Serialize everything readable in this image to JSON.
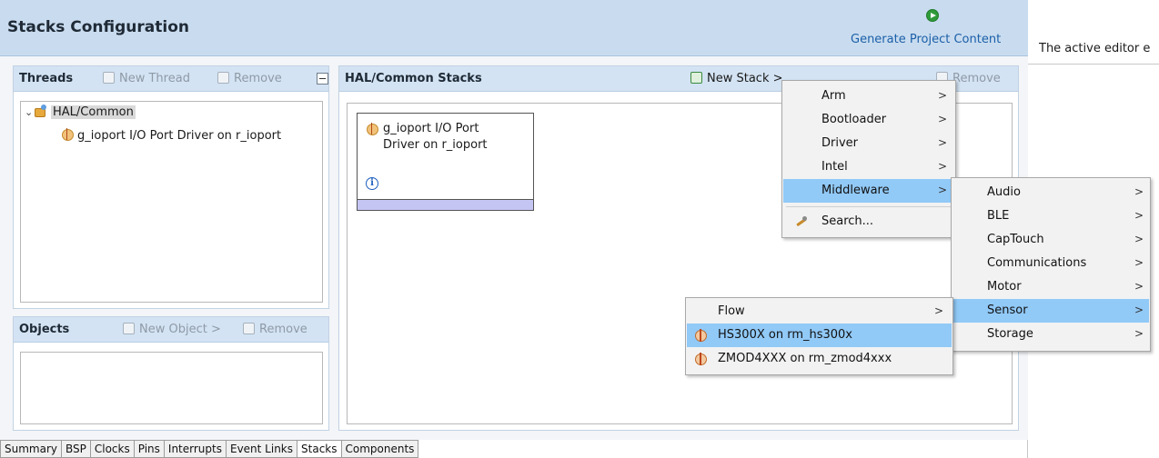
{
  "header": {
    "title": "Stacks Configuration",
    "generate_label": "Generate Project Content"
  },
  "threads": {
    "title": "Threads",
    "new_thread": "New Thread",
    "remove": "Remove",
    "tree_root": "HAL/Common",
    "tree_child": "g_ioport I/O Port Driver on r_ioport"
  },
  "objects": {
    "title": "Objects",
    "new_object": "New Object >",
    "remove": "Remove"
  },
  "stacks": {
    "title": "HAL/Common Stacks",
    "new_stack": "New Stack",
    "new_stack_arrow": ">",
    "remove": "Remove",
    "block_line1": "g_ioport I/O Port",
    "block_line2": "Driver on r_ioport",
    "info_glyph": "i"
  },
  "menu1": {
    "items": [
      {
        "label": "Arm",
        "arrow": ">"
      },
      {
        "label": "Bootloader",
        "arrow": ">"
      },
      {
        "label": "Driver",
        "arrow": ">"
      },
      {
        "label": "Intel",
        "arrow": ">"
      },
      {
        "label": "Middleware",
        "arrow": ">"
      }
    ],
    "search": "Search..."
  },
  "menu2": {
    "items": [
      {
        "label": "Audio",
        "arrow": ">"
      },
      {
        "label": "BLE",
        "arrow": ">"
      },
      {
        "label": "CapTouch",
        "arrow": ">"
      },
      {
        "label": "Communications",
        "arrow": ">"
      },
      {
        "label": "Motor",
        "arrow": ">"
      },
      {
        "label": "Sensor",
        "arrow": ">"
      },
      {
        "label": "Storage",
        "arrow": ">"
      }
    ]
  },
  "menu3": {
    "items": [
      {
        "label": "Flow",
        "arrow": ">"
      },
      {
        "label": "HS300X on rm_hs300x"
      },
      {
        "label": "ZMOD4XXX on rm_zmod4xxx"
      }
    ]
  },
  "tabs": [
    "Summary",
    "BSP",
    "Clocks",
    "Pins",
    "Interrupts",
    "Event Links",
    "Stacks",
    "Components"
  ],
  "side": {
    "text": "The active editor e"
  },
  "colors": {
    "header_bg": "#c9dcef",
    "panel_head_bg": "#d3e3f3",
    "menu_highlight": "#91c9f7",
    "stack_bar": "#c5c5f3"
  }
}
